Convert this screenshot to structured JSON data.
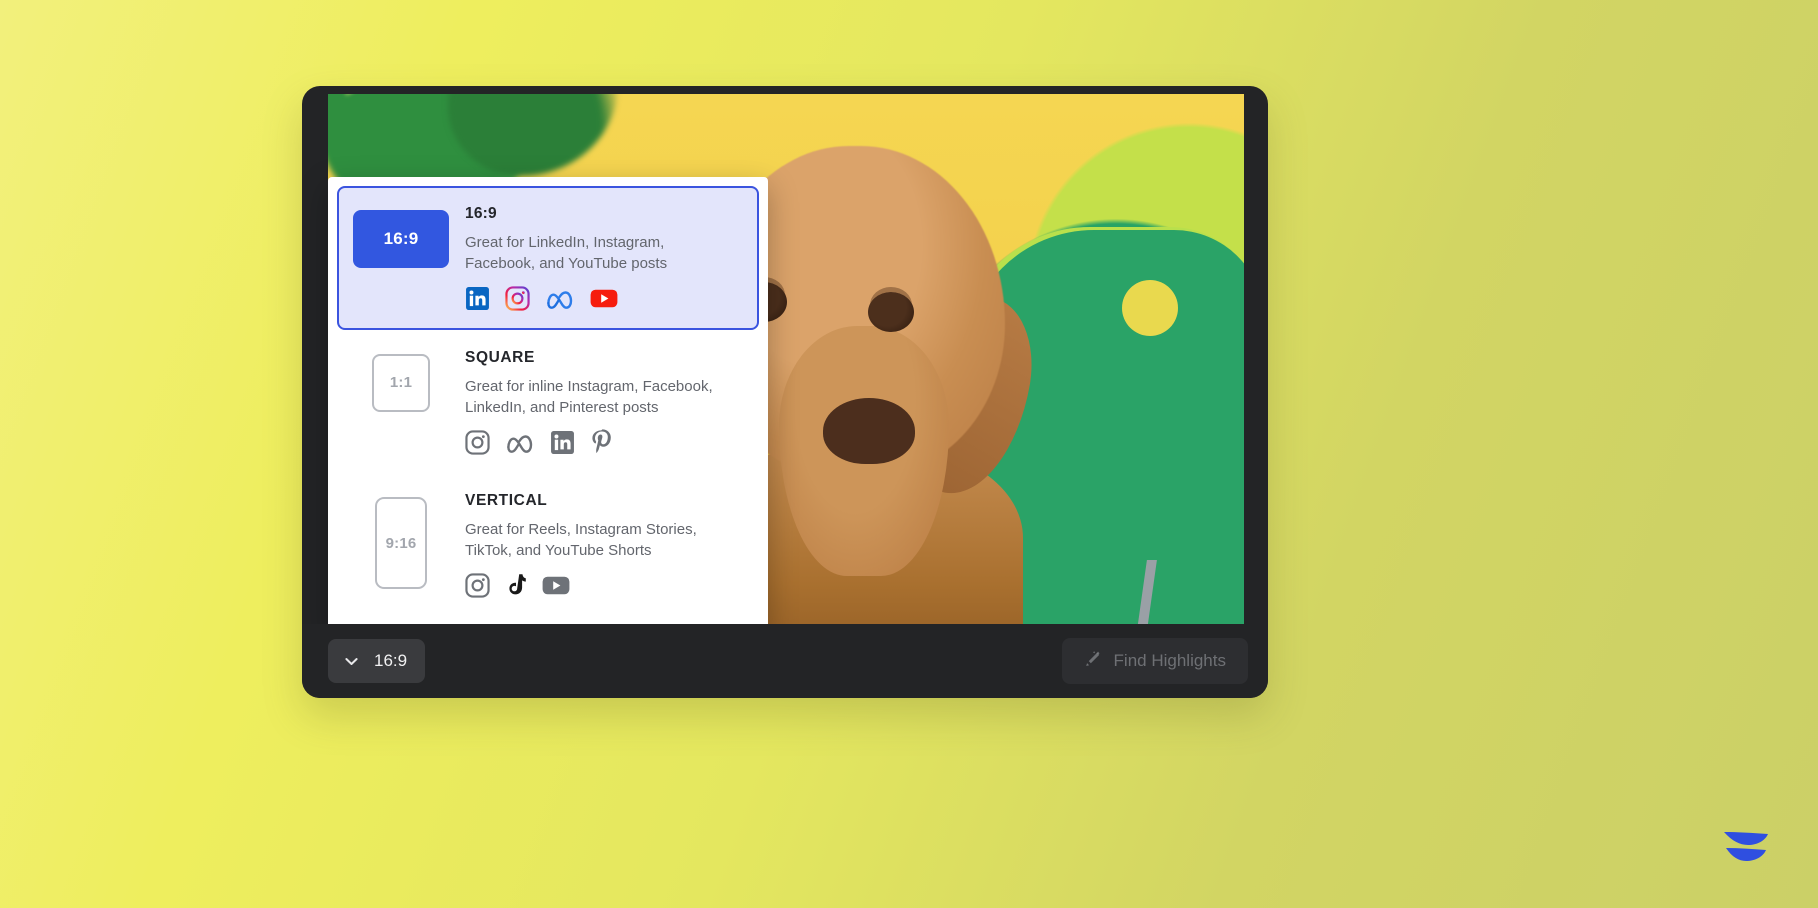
{
  "theme": {
    "background_start": "#F2F07C",
    "background_end": "#CBD067",
    "window_bg": "#232426",
    "accent_blue": "#3257E0",
    "selected_bg": "#E3E5FB",
    "selected_border": "#3B54DF",
    "logo_blue": "#2F4FE0"
  },
  "app_window": {
    "name": "video-editor-window"
  },
  "video": {
    "alt": "Close-up of a tan terrier dog in front of a yellow wall with a green chair"
  },
  "aspect_ratio_popover": {
    "options": [
      {
        "id": "16-9",
        "thumb_label": "16:9",
        "title": "16:9",
        "description": "Great for LinkedIn, Instagram, Facebook, and YouTube posts",
        "selected": true,
        "platforms": [
          {
            "name": "linkedin-icon",
            "label": "LinkedIn"
          },
          {
            "name": "instagram-icon",
            "label": "Instagram"
          },
          {
            "name": "meta-icon",
            "label": "Meta"
          },
          {
            "name": "youtube-icon",
            "label": "YouTube"
          }
        ]
      },
      {
        "id": "1-1",
        "thumb_label": "1:1",
        "title": "SQUARE",
        "description": "Great for inline Instagram, Facebook, LinkedIn, and Pinterest posts",
        "selected": false,
        "platforms": [
          {
            "name": "instagram-icon",
            "label": "Instagram"
          },
          {
            "name": "meta-icon",
            "label": "Meta"
          },
          {
            "name": "linkedin-icon",
            "label": "LinkedIn"
          },
          {
            "name": "pinterest-icon",
            "label": "Pinterest"
          }
        ]
      },
      {
        "id": "9-16",
        "thumb_label": "9:16",
        "title": "VERTICAL",
        "description": "Great for Reels, Instagram Stories, TikTok, and YouTube Shorts",
        "selected": false,
        "platforms": [
          {
            "name": "instagram-icon",
            "label": "Instagram"
          },
          {
            "name": "tiktok-icon",
            "label": "TikTok"
          },
          {
            "name": "youtube-icon",
            "label": "YouTube"
          }
        ]
      }
    ]
  },
  "toolbar": {
    "ratio_button": {
      "label": "16:9",
      "icon": "chevron-down-icon"
    },
    "find_highlights": {
      "label": "Find Highlights",
      "icon": "magic-wand-icon",
      "disabled": true
    }
  },
  "brand": {
    "logo_name": "descript-wing-logo"
  }
}
